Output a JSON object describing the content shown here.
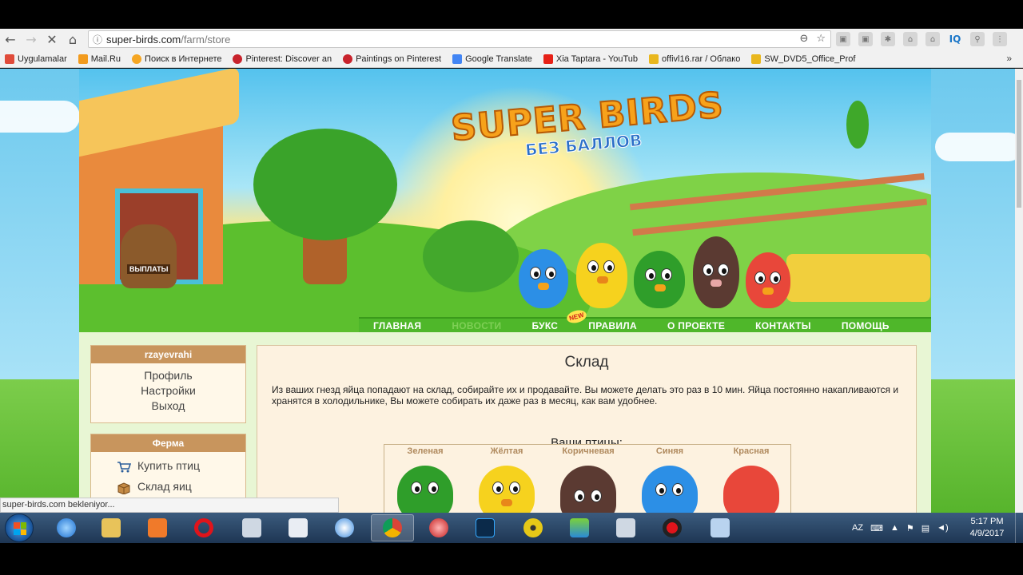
{
  "browser": {
    "url_host": "super-birds.com",
    "url_path": "/farm/store",
    "bookmarks": [
      {
        "label": "Uygulamalar",
        "color": "#e04b3a"
      },
      {
        "label": "Mail.Ru",
        "color": "#f29b1e"
      },
      {
        "label": "Поиск в Интернете",
        "color": "#f5a623"
      },
      {
        "label": "Pinterest: Discover an",
        "color": "#c8232c"
      },
      {
        "label": "Paintings on Pinterest",
        "color": "#c8232c"
      },
      {
        "label": "Google Translate",
        "color": "#4285f4"
      },
      {
        "label": "Xia Taptara - YouTub",
        "color": "#e62117"
      },
      {
        "label": "offivl16.rar / Облако",
        "color": "#e9b71e"
      },
      {
        "label": "SW_DVD5_Office_Prof",
        "color": "#e9b71e"
      }
    ],
    "status_text": "super-birds.com bekleniyor..."
  },
  "site": {
    "logo_main": "SUPER BIRDS",
    "logo_sub": "БЕЗ БАЛЛОВ",
    "sack_label": "ВЫПЛАТЫ",
    "new_badge": "NEW",
    "menu": [
      "ГЛАВНАЯ",
      "НОВОСТИ",
      "БУКС",
      "ПРАВИЛА",
      "О ПРОЕКТЕ",
      "КОНТАКТЫ",
      "ПОМОЩЬ"
    ],
    "user_box": {
      "username": "rzayevrahi",
      "links": [
        "Профиль",
        "Настройки",
        "Выход"
      ]
    },
    "farm_box": {
      "title": "Ферма",
      "links": [
        "Купить птиц",
        "Склад яиц"
      ]
    },
    "main": {
      "title": "Склад",
      "description": "Из ваших гнезд яйца попадают на склад, собирайте их и продавайте. Вы можете делать это раз в 10 мин. Яйца постоянно накапливаются и хранятся в холодильнике, Вы можете собирать их даже раз в месяц, как вам удобнее.",
      "birds_heading": "Ваши птицы:",
      "birds": [
        {
          "label": "Зеленая",
          "color": "#2f9e2a"
        },
        {
          "label": "Жёлтая",
          "color": "#f6d21e"
        },
        {
          "label": "Коричневая",
          "color": "#5b3a32"
        },
        {
          "label": "Синяя",
          "color": "#2c8fe6"
        },
        {
          "label": "Красная",
          "color": "#e8473a"
        }
      ]
    }
  },
  "taskbar": {
    "lang": "AZ",
    "time": "5:17 PM",
    "date": "4/9/2017"
  }
}
